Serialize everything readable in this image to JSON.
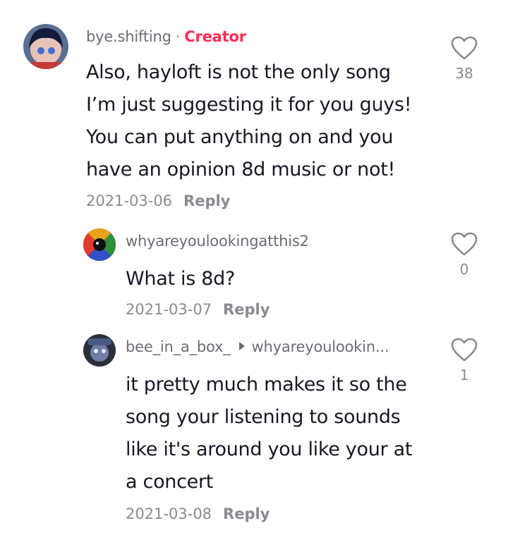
{
  "comments": [
    {
      "username": "bye.shifting",
      "separator": "·",
      "badge": "Creator",
      "text_lines": [
        "Also, hayloft is not the only song",
        "I’m just suggesting it for you guys!",
        "You can put anything on and you",
        "have an opinion 8d music or not!"
      ],
      "date": "2021-03-06",
      "reply_label": "Reply",
      "likes": "38"
    },
    {
      "username": "whyareyoulookingatthis2",
      "text_lines": [
        "What is 8d?"
      ],
      "date": "2021-03-07",
      "reply_label": "Reply",
      "likes": "0"
    },
    {
      "username": "bee_in_a_box_",
      "reply_to": "whyareyoulookin...",
      "text_lines": [
        "it pretty much makes it so the",
        "song your listening to sounds",
        "like it's around you like your at",
        "a concert"
      ],
      "date": "2021-03-08",
      "reply_label": "Reply",
      "likes": "1"
    }
  ],
  "icons": {
    "like": "heart-outline-icon",
    "reply_indicator": "play-triangle-icon"
  },
  "colors": {
    "creator_badge": "#fe2c55",
    "username": "#6b6d75",
    "meta": "#8a8b91",
    "text": "#161823"
  }
}
